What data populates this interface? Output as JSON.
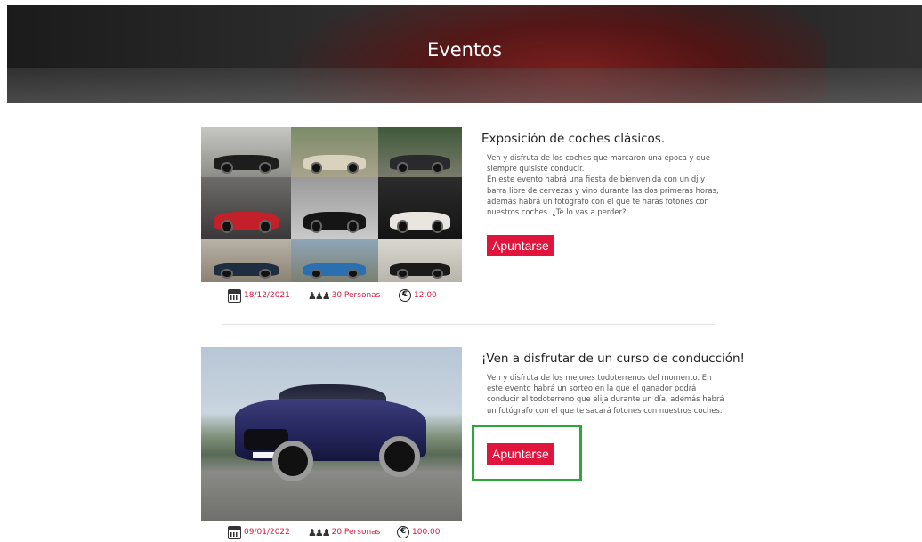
{
  "page": {
    "title": "Eventos"
  },
  "events": [
    {
      "title": "Exposición de coches clásicos.",
      "description_lines": [
        "Ven y disfruta de los coches que marcaron una época y que",
        "siempre quisiste conducir.",
        "En este evento habrá una fiesta de bienvenida con un dj y",
        "barra libre de cervezas y vino durante las dos primeras horas,",
        "además habrá un fotógrafo con el que te harás fotones con",
        "nuestros coches. ¿Te lo vas a perder?"
      ],
      "button_label": "Apuntarse",
      "date": "18/12/2021",
      "capacity": "30 Personas",
      "price": "12.00"
    },
    {
      "title": "¡Ven a disfrutar de un curso de conducción!",
      "description_lines": [
        "Ven y disfruta de los mejores todoterrenos del momento. En",
        "este evento habrá un sorteo en la que el ganador podrá",
        "conducir el todoterreno que elija durante un día, además habrá",
        "un fotógrafo con el que te sacará fotones con nuestros coches."
      ],
      "button_label": "Apuntarse",
      "date": "09/01/2022",
      "capacity": "20 Personas",
      "price": "100.00"
    }
  ],
  "icons": {
    "date": "calendar-icon",
    "capacity": "people-icon",
    "price": "euro-icon"
  },
  "colors": {
    "accent": "#e0143c",
    "highlight": "#2aa838"
  }
}
